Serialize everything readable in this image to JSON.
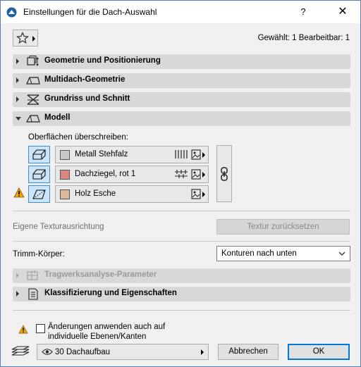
{
  "window": {
    "title": "Einstellungen für die Dach-Auswahl",
    "help_label": "?",
    "close_label": "✕"
  },
  "header": {
    "selection_info": "Gewählt: 1 Bearbeitbar: 1"
  },
  "sections": {
    "geometrie": "Geometrie und Positionierung",
    "multidach": "Multidach-Geometrie",
    "grundriss": "Grundriss und Schnitt",
    "modell": "Modell",
    "tragwerk": "Tragwerksanalyse-Parameter",
    "klassifizierung": "Klassifizierung und Eigenschaften"
  },
  "modell": {
    "override_label": "Oberflächen überschreiben:",
    "materials": [
      {
        "name": "Metall Stehfalz",
        "swatch": "#c8c8c8"
      },
      {
        "name": "Dachziegel, rot 1",
        "swatch": "#d98880"
      },
      {
        "name": "Holz Esche",
        "swatch": "#d9b99a"
      }
    ]
  },
  "texture": {
    "label": "Eigene Texturausrichtung",
    "reset_button": "Textur zurücksetzen"
  },
  "trim": {
    "label": "Trimm-Körper:",
    "value": "Konturen nach unten"
  },
  "footer": {
    "apply_checkbox": "Änderungen anwenden auch auf individuelle Ebenen/Kanten",
    "layer_value": "30 Dachaufbau",
    "cancel_button": "Abbrechen",
    "ok_button": "OK"
  },
  "colors": {
    "accent": "#0078d7",
    "selected_bg": "#cce4f7",
    "warning": "#e8a317",
    "section_bg": "#d8d8d8"
  },
  "icons": [
    "app-icon",
    "star-icon",
    "geometry-icon",
    "multiroof-icon",
    "floorplan-icon",
    "model-icon",
    "structural-icon",
    "classification-icon",
    "surface-icon",
    "pattern-icon",
    "texture-icon",
    "chain-link-icon",
    "warning-icon",
    "chevron-down-icon",
    "layer-icon",
    "eye-icon"
  ]
}
